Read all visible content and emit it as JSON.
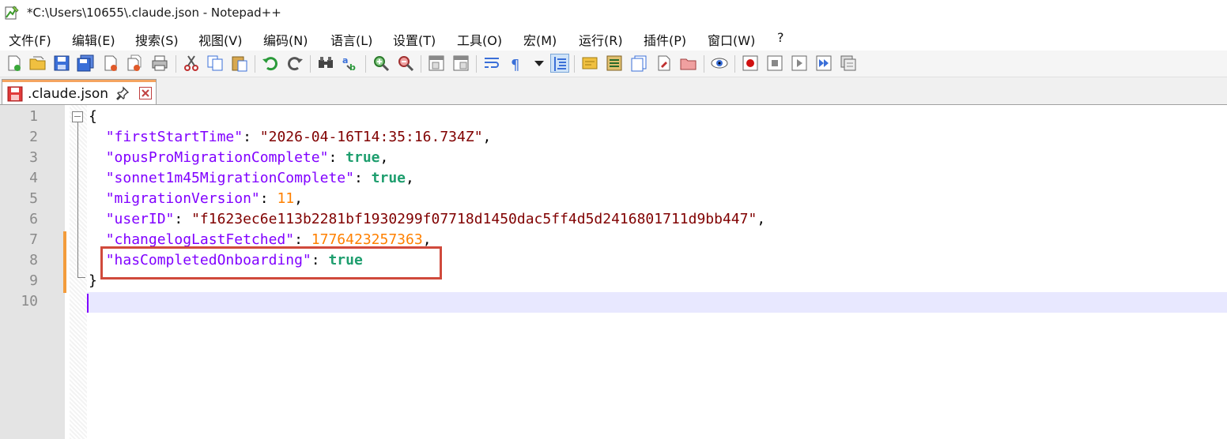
{
  "window": {
    "title": "*C:\\Users\\10655\\.claude.json - Notepad++"
  },
  "menu": [
    {
      "label": "文件(F)"
    },
    {
      "label": "编辑(E)"
    },
    {
      "label": "搜索(S)"
    },
    {
      "label": "视图(V)"
    },
    {
      "label": "编码(N)"
    },
    {
      "label": "语言(L)"
    },
    {
      "label": "设置(T)"
    },
    {
      "label": "工具(O)"
    },
    {
      "label": "宏(M)"
    },
    {
      "label": "运行(R)"
    },
    {
      "label": "插件(P)"
    },
    {
      "label": "窗口(W)"
    },
    {
      "label": "?"
    }
  ],
  "toolbar": {
    "icons": [
      "new-file-icon",
      "open-file-icon",
      "save-icon",
      "save-all-icon",
      "close-icon",
      "close-all-icon",
      "print-icon",
      "cut-icon",
      "copy-icon",
      "paste-icon",
      "undo-icon",
      "redo-icon",
      "find-icon",
      "replace-icon",
      "zoom-in-icon",
      "zoom-out-icon",
      "sync-vertical-icon",
      "sync-horizontal-icon",
      "word-wrap-icon",
      "show-all-chars-icon",
      "indent-guide-icon",
      "doc-map-icon",
      "function-list-icon",
      "folder-workspace-icon",
      "monitoring-icon",
      "record-macro-icon",
      "stop-macro-icon",
      "play-macro-icon",
      "run-macro-multiple-icon",
      "save-macro-icon"
    ]
  },
  "tab": {
    "label": ".claude.json",
    "icon": "unsaved-file-icon"
  },
  "editor": {
    "line_numbers": [
      "1",
      "2",
      "3",
      "4",
      "5",
      "6",
      "7",
      "8",
      "9",
      "10"
    ],
    "lines": [
      [
        {
          "t": "p",
          "v": "{"
        }
      ],
      [
        {
          "t": "p",
          "v": "  "
        },
        {
          "t": "k",
          "v": "\"firstStartTime\""
        },
        {
          "t": "p",
          "v": ": "
        },
        {
          "t": "s",
          "v": "\"2026-04-16T14:35:16.734Z\""
        },
        {
          "t": "p",
          "v": ","
        }
      ],
      [
        {
          "t": "p",
          "v": "  "
        },
        {
          "t": "k",
          "v": "\"opusProMigrationComplete\""
        },
        {
          "t": "p",
          "v": ": "
        },
        {
          "t": "b",
          "v": "true"
        },
        {
          "t": "p",
          "v": ","
        }
      ],
      [
        {
          "t": "p",
          "v": "  "
        },
        {
          "t": "k",
          "v": "\"sonnet1m45MigrationComplete\""
        },
        {
          "t": "p",
          "v": ": "
        },
        {
          "t": "b",
          "v": "true"
        },
        {
          "t": "p",
          "v": ","
        }
      ],
      [
        {
          "t": "p",
          "v": "  "
        },
        {
          "t": "k",
          "v": "\"migrationVersion\""
        },
        {
          "t": "p",
          "v": ": "
        },
        {
          "t": "n",
          "v": "11"
        },
        {
          "t": "p",
          "v": ","
        }
      ],
      [
        {
          "t": "p",
          "v": "  "
        },
        {
          "t": "k",
          "v": "\"userID\""
        },
        {
          "t": "p",
          "v": ": "
        },
        {
          "t": "s",
          "v": "\"f1623ec6e113b2281bf1930299f07718d1450dac5ff4d5d2416801711d9bb447\""
        },
        {
          "t": "p",
          "v": ","
        }
      ],
      [
        {
          "t": "p",
          "v": "  "
        },
        {
          "t": "k",
          "v": "\"changelogLastFetched\""
        },
        {
          "t": "p",
          "v": ": "
        },
        {
          "t": "n",
          "v": "1776423257363"
        },
        {
          "t": "p",
          "v": ","
        }
      ],
      [
        {
          "t": "p",
          "v": "  "
        },
        {
          "t": "k",
          "v": "\"hasCompletedOnboarding\""
        },
        {
          "t": "p",
          "v": ": "
        },
        {
          "t": "b",
          "v": "true"
        }
      ],
      [
        {
          "t": "p",
          "v": "}"
        }
      ],
      []
    ]
  },
  "colors": {
    "key": "#8000ff",
    "string": "#800000",
    "boolean": "#1e9e6e",
    "number": "#ff8000",
    "change_marker": "#f39c3c",
    "highlight_box": "#d04a3c"
  }
}
